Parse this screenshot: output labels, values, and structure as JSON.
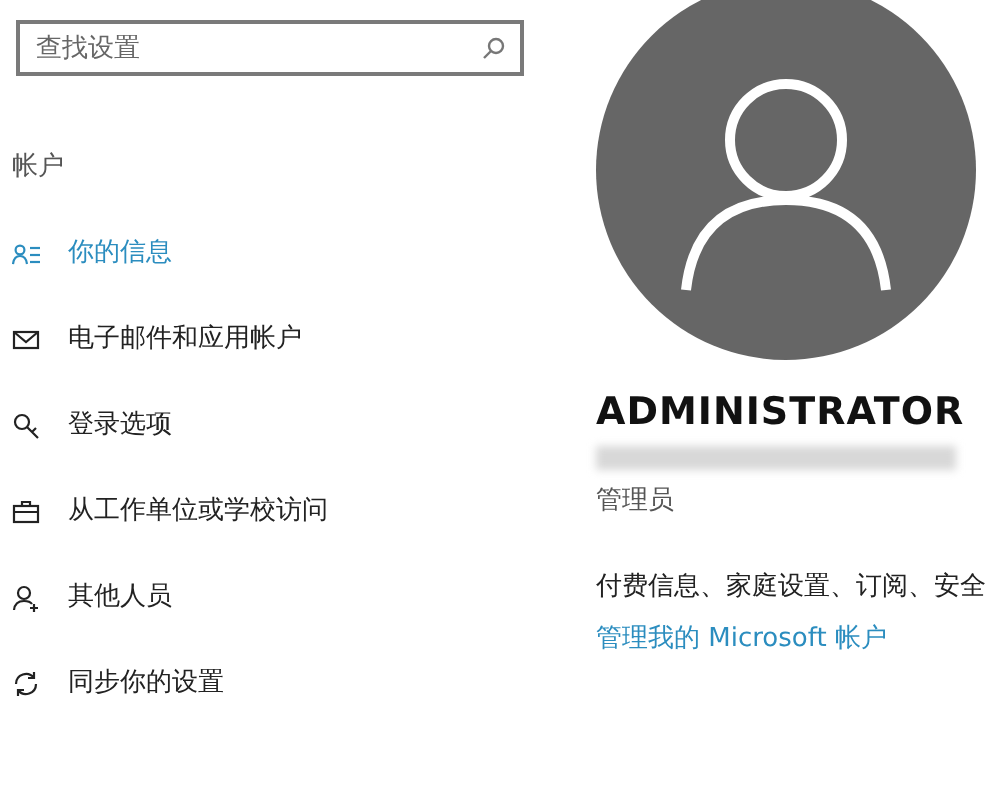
{
  "search": {
    "placeholder": "查找设置"
  },
  "sidebar": {
    "heading": "帐户",
    "items": [
      {
        "label": "你的信息",
        "kind": "info",
        "selected": true
      },
      {
        "label": "电子邮件和应用帐户",
        "kind": "mail",
        "selected": false
      },
      {
        "label": "登录选项",
        "kind": "key",
        "selected": false
      },
      {
        "label": "从工作单位或学校访问",
        "kind": "briefcase",
        "selected": false
      },
      {
        "label": "其他人员",
        "kind": "person",
        "selected": false
      },
      {
        "label": "同步你的设置",
        "kind": "sync",
        "selected": false
      }
    ]
  },
  "profile": {
    "name": "ADMINISTRATOR",
    "role": "管理员",
    "description": "付费信息、家庭设置、订阅、安全",
    "link": "管理我的 Microsoft 帐户"
  }
}
